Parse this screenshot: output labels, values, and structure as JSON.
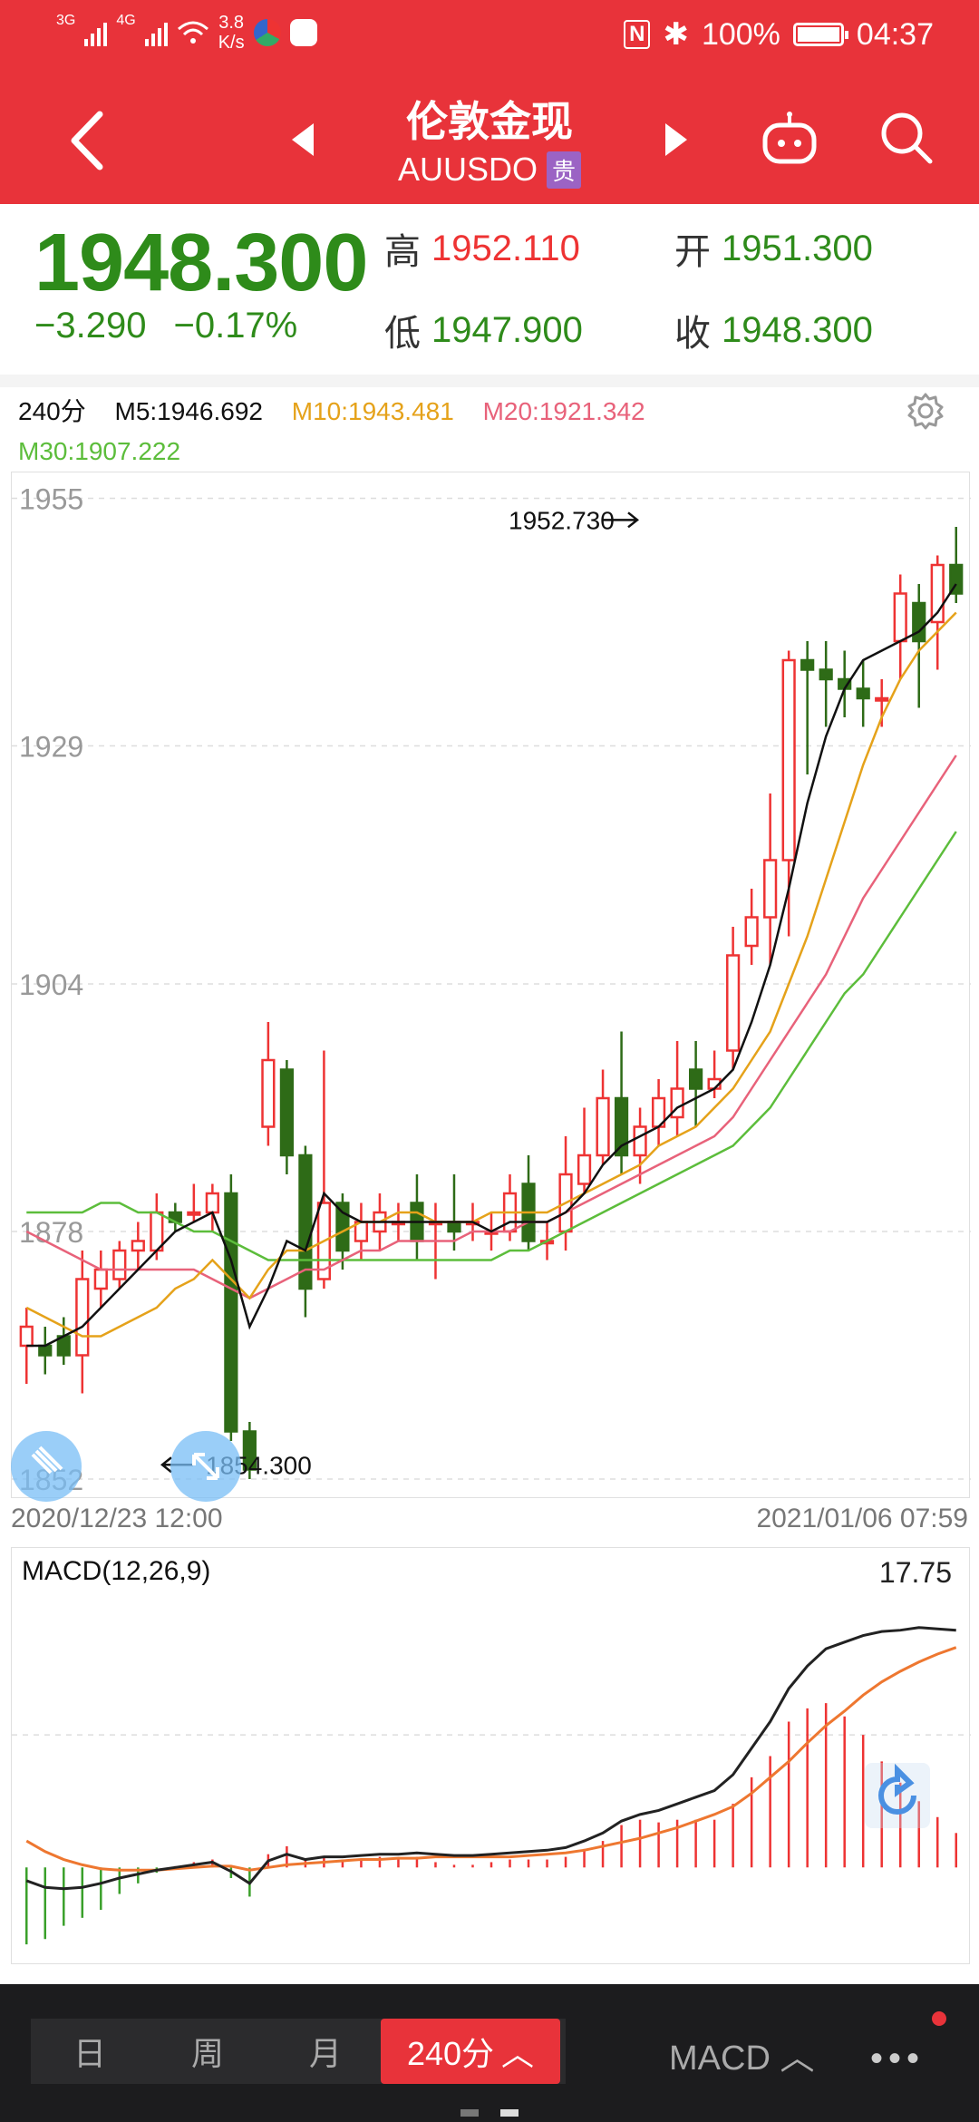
{
  "status": {
    "net1": "3G",
    "net2": "4G",
    "speed_value": "3.8",
    "speed_unit": "K/s",
    "battery": "100%",
    "time": "04:37"
  },
  "nav": {
    "title": "伦敦金现",
    "code": "AUUSDO",
    "tag": "贵"
  },
  "quote": {
    "price": "1948.300",
    "change": "−3.290",
    "change_pct": "−0.17%",
    "high_label": "高",
    "high": "1952.110",
    "open_label": "开",
    "open": "1951.300",
    "low_label": "低",
    "low": "1947.900",
    "close_label": "收",
    "close": "1948.300"
  },
  "indicators": {
    "period": "240分",
    "m5": "M5:1946.692",
    "m10": "M10:1943.481",
    "m20": "M20:1921.342",
    "m30": "M30:1907.222"
  },
  "colors": {
    "brand": "#e8333a",
    "up": "#e33",
    "down": "#2e6b17",
    "m5": "#111111",
    "m10": "#e5a21a",
    "m20": "#e8627a",
    "m30": "#5cbd3b",
    "macd_dif": "#222222",
    "macd_dea": "#ee7730"
  },
  "chart_data": {
    "type": "candlestick",
    "y_ticks": [
      "1955",
      "1929",
      "1904",
      "1878",
      "1852"
    ],
    "ylim": [
      1852,
      1956
    ],
    "max_annotation": "1952.730",
    "min_annotation": "1854.300",
    "x_start": "2020/12/23 12:00",
    "x_end": "2021/01/06 07:59",
    "candles": [
      {
        "o": 1866,
        "c": 1868,
        "h": 1870,
        "l": 1862
      },
      {
        "o": 1866,
        "c": 1865,
        "h": 1868,
        "l": 1863
      },
      {
        "o": 1867,
        "c": 1865,
        "h": 1869,
        "l": 1864
      },
      {
        "o": 1865,
        "c": 1873,
        "h": 1876,
        "l": 1861
      },
      {
        "o": 1872,
        "c": 1874,
        "h": 1876,
        "l": 1870
      },
      {
        "o": 1873,
        "c": 1876,
        "h": 1877,
        "l": 1872
      },
      {
        "o": 1876,
        "c": 1877,
        "h": 1879,
        "l": 1874
      },
      {
        "o": 1876,
        "c": 1880,
        "h": 1882,
        "l": 1875
      },
      {
        "o": 1880,
        "c": 1879,
        "h": 1881,
        "l": 1878
      },
      {
        "o": 1880,
        "c": 1880,
        "h": 1883,
        "l": 1879
      },
      {
        "o": 1880,
        "c": 1882,
        "h": 1883,
        "l": 1878
      },
      {
        "o": 1882,
        "c1": 0,
        "c": 1857,
        "h": 1884,
        "l": 1856
      },
      {
        "o": 1857,
        "c": 1853,
        "h": 1858,
        "l": 1852
      },
      {
        "o": 1889,
        "c": 1896,
        "h": 1900,
        "l": 1887
      },
      {
        "o": 1895,
        "c": 1886,
        "h": 1896,
        "l": 1884
      },
      {
        "o": 1886,
        "c": 1872,
        "h": 1887,
        "l": 1869
      },
      {
        "o": 1873,
        "c": 1881,
        "h": 1897,
        "l": 1872
      },
      {
        "o": 1881,
        "c": 1876,
        "h": 1882,
        "l": 1874
      },
      {
        "o": 1877,
        "c": 1879,
        "h": 1881,
        "l": 1875
      },
      {
        "o": 1878,
        "c": 1880,
        "h": 1882,
        "l": 1876
      },
      {
        "o": 1879,
        "c": 1879,
        "h": 1881,
        "l": 1877
      },
      {
        "o": 1881,
        "c": 1877,
        "h": 1884,
        "l": 1875
      },
      {
        "o": 1879,
        "c": 1879,
        "h": 1881,
        "l": 1873
      },
      {
        "o": 1879,
        "c": 1878,
        "h": 1884,
        "l": 1876
      },
      {
        "o": 1879,
        "c": 1879,
        "h": 1881,
        "l": 1877
      },
      {
        "o": 1878,
        "c": 1878,
        "h": 1880,
        "l": 1876
      },
      {
        "o": 1878,
        "c": 1882,
        "h": 1884,
        "l": 1877
      },
      {
        "o": 1883,
        "c": 1877,
        "h": 1886,
        "l": 1876
      },
      {
        "o": 1877,
        "c": 1877,
        "h": 1879,
        "l": 1875
      },
      {
        "o": 1878,
        "c": 1884,
        "h": 1888,
        "l": 1876
      },
      {
        "o": 1883,
        "c": 1886,
        "h": 1891,
        "l": 1882
      },
      {
        "o": 1886,
        "c": 1892,
        "h": 1895,
        "l": 1885
      },
      {
        "o": 1892,
        "c": 1886,
        "h": 1899,
        "l": 1884
      },
      {
        "o": 1886,
        "c": 1889,
        "h": 1891,
        "l": 1883
      },
      {
        "o": 1889,
        "c": 1892,
        "h": 1894,
        "l": 1887
      },
      {
        "o": 1890,
        "c": 1893,
        "h": 1898,
        "l": 1888
      },
      {
        "o": 1895,
        "c": 1893,
        "h": 1898,
        "l": 1889
      },
      {
        "o": 1893,
        "c": 1894,
        "h": 1897,
        "l": 1892
      },
      {
        "o": 1897,
        "c": 1907,
        "h": 1910,
        "l": 1895
      },
      {
        "o": 1908,
        "c": 1911,
        "h": 1914,
        "l": 1906
      },
      {
        "o": 1911,
        "c": 1917,
        "h": 1924,
        "l": 1906
      },
      {
        "o": 1917,
        "c": 1938,
        "h": 1939,
        "l": 1909
      },
      {
        "o": 1938,
        "c": 1937,
        "h": 1940,
        "l": 1926
      },
      {
        "o": 1937,
        "c": 1936,
        "h": 1940,
        "l": 1931
      },
      {
        "o": 1936,
        "c": 1935,
        "h": 1939,
        "l": 1932
      },
      {
        "o": 1935,
        "c": 1934,
        "h": 1938,
        "l": 1931
      },
      {
        "o": 1934,
        "c": 1934,
        "h": 1936,
        "l": 1931
      },
      {
        "o": 1940,
        "c": 1945,
        "h": 1947,
        "l": 1936
      },
      {
        "o": 1944,
        "c": 1940,
        "h": 1946,
        "l": 1933
      },
      {
        "o": 1942,
        "c": 1948,
        "h": 1949,
        "l": 1937
      },
      {
        "o": 1948,
        "c": 1945,
        "h": 1952,
        "l": 1944
      }
    ],
    "ma5": [
      1866,
      1866,
      1867,
      1868,
      1870,
      1872,
      1874,
      1876,
      1878,
      1879,
      1880,
      1875,
      1868,
      1872,
      1877,
      1876,
      1882,
      1880,
      1879,
      1879,
      1879,
      1879,
      1879,
      1879,
      1879,
      1878,
      1879,
      1879,
      1879,
      1880,
      1882,
      1885,
      1887,
      1888,
      1889,
      1891,
      1892,
      1893,
      1895,
      1900,
      1906,
      1914,
      1923,
      1930,
      1935,
      1938,
      1939,
      1940,
      1941,
      1943,
      1946
    ],
    "ma10": [
      1870,
      1869,
      1868,
      1867,
      1867,
      1868,
      1869,
      1870,
      1872,
      1873,
      1875,
      1873,
      1871,
      1874,
      1876,
      1876,
      1877,
      1878,
      1879,
      1879,
      1880,
      1880,
      1879,
      1879,
      1879,
      1880,
      1880,
      1880,
      1880,
      1881,
      1882,
      1883,
      1884,
      1885,
      1887,
      1888,
      1889,
      1891,
      1893,
      1896,
      1899,
      1904,
      1909,
      1915,
      1921,
      1927,
      1932,
      1936,
      1939,
      1941,
      1943
    ],
    "ma20": [
      1878,
      1877,
      1876,
      1875,
      1874,
      1874,
      1874,
      1874,
      1874,
      1874,
      1873,
      1872,
      1871,
      1872,
      1873,
      1874,
      1874,
      1875,
      1876,
      1876,
      1877,
      1877,
      1877,
      1877,
      1878,
      1878,
      1878,
      1879,
      1879,
      1880,
      1881,
      1882,
      1883,
      1884,
      1885,
      1886,
      1887,
      1888,
      1890,
      1893,
      1896,
      1899,
      1902,
      1905,
      1909,
      1913,
      1916,
      1919,
      1922,
      1925,
      1928
    ],
    "ma30": [
      1880,
      1880,
      1880,
      1880,
      1881,
      1881,
      1880,
      1880,
      1879,
      1878,
      1878,
      1877,
      1876,
      1875,
      1875,
      1875,
      1875,
      1875,
      1875,
      1875,
      1875,
      1875,
      1875,
      1875,
      1875,
      1875,
      1876,
      1876,
      1877,
      1878,
      1879,
      1880,
      1881,
      1882,
      1883,
      1884,
      1885,
      1886,
      1887,
      1889,
      1891,
      1894,
      1897,
      1900,
      1903,
      1905,
      1908,
      1911,
      1914,
      1917,
      1920
    ]
  },
  "macd": {
    "label": "MACD(12,26,9)",
    "value": "17.75",
    "ylim": [
      -6,
      20
    ],
    "dif": [
      -1,
      -1.5,
      -1.6,
      -1.5,
      -1.2,
      -0.8,
      -0.5,
      -0.2,
      0,
      0.2,
      0.4,
      -0.3,
      -1.2,
      0.5,
      1,
      0.6,
      0.8,
      0.8,
      0.9,
      1,
      1,
      1.1,
      1,
      0.9,
      0.9,
      1,
      1.1,
      1.2,
      1.3,
      1.5,
      2,
      2.6,
      3.5,
      4,
      4.3,
      4.8,
      5.3,
      5.8,
      7,
      9,
      11,
      13.5,
      15.2,
      16.5,
      17,
      17.5,
      17.8,
      17.9,
      18.1,
      18,
      17.9
    ],
    "dea": [
      2,
      1.2,
      0.6,
      0.2,
      -0.1,
      -0.2,
      -0.2,
      -0.2,
      -0.1,
      0,
      0.1,
      0.1,
      -0.2,
      0,
      0.2,
      0.3,
      0.4,
      0.5,
      0.6,
      0.6,
      0.7,
      0.7,
      0.8,
      0.8,
      0.8,
      0.8,
      0.8,
      0.9,
      1,
      1.1,
      1.3,
      1.6,
      1.9,
      2.2,
      2.6,
      3,
      3.5,
      4,
      4.6,
      5.6,
      6.8,
      8,
      9.4,
      10.7,
      11.8,
      13,
      14,
      14.8,
      15.5,
      16.1,
      16.6
    ],
    "hist": [
      -5.8,
      -5.4,
      -4.4,
      -3.8,
      -3.2,
      -2,
      -1.2,
      -0.4,
      0.1,
      0.4,
      0.6,
      -0.8,
      -2.2,
      1,
      1.6,
      0.6,
      0.8,
      0.6,
      0.6,
      0.8,
      0.6,
      0.8,
      0.4,
      0.2,
      0.2,
      0.4,
      0.6,
      0.6,
      0.6,
      0.8,
      1.4,
      2,
      3.2,
      3.6,
      3.4,
      3.6,
      3.6,
      3.6,
      4.8,
      6.8,
      8.4,
      11,
      12,
      12.4,
      11.4,
      10,
      8,
      6.4,
      5,
      3.8,
      2.6
    ]
  },
  "bottom": {
    "tab_day": "日",
    "tab_week": "周",
    "tab_month": "月",
    "tab_active": "240分",
    "indicator": "MACD"
  }
}
